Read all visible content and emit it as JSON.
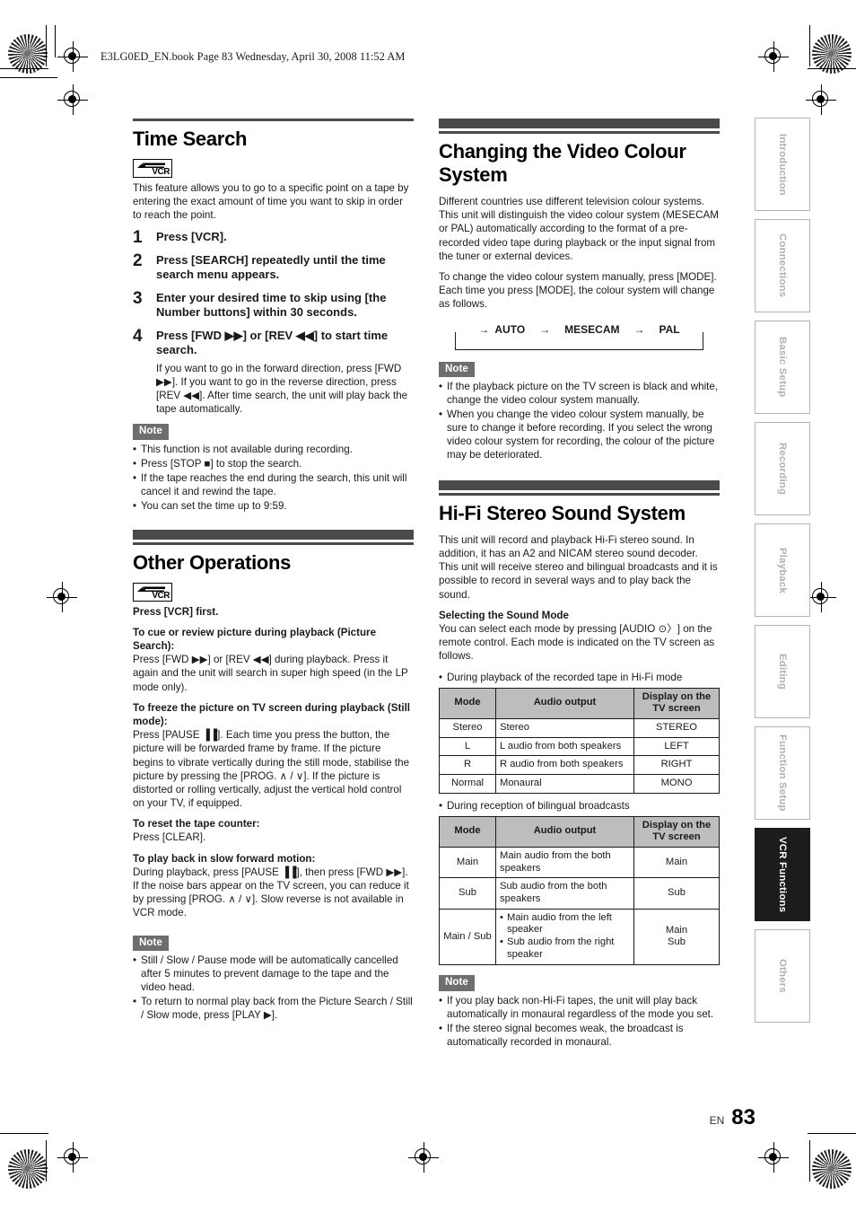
{
  "header": {
    "file_line": "E3LG0ED_EN.book  Page 83  Wednesday, April 30, 2008  11:52 AM"
  },
  "footer": {
    "lang": "EN",
    "page_number": "83"
  },
  "side_tabs": {
    "items": [
      {
        "label": "Introduction",
        "active": false
      },
      {
        "label": "Connections",
        "active": false
      },
      {
        "label": "Basic Setup",
        "active": false
      },
      {
        "label": "Recording",
        "active": false
      },
      {
        "label": "Playback",
        "active": false
      },
      {
        "label": "Editing",
        "active": false
      },
      {
        "label": "Function Setup",
        "active": false
      },
      {
        "label": "VCR Functions",
        "active": true
      },
      {
        "label": "Others",
        "active": false
      }
    ]
  },
  "icons": {
    "vcr_label": "VCR"
  },
  "left_column": {
    "time_search": {
      "title": "Time Search",
      "intro": "This feature allows you to go to a specific point on a tape by entering the exact amount of time you want to skip in order to reach the point.",
      "steps": [
        {
          "num": "1",
          "text": "Press [VCR].",
          "detail": ""
        },
        {
          "num": "2",
          "text": "Press [SEARCH] repeatedly until the time search menu appears.",
          "detail": ""
        },
        {
          "num": "3",
          "text": "Enter your desired time to skip using [the Number buttons] within 30 seconds.",
          "detail": ""
        },
        {
          "num": "4",
          "text": "Press [FWD ▶▶] or [REV ◀◀] to start time search.",
          "detail": "If you want to go in the forward direction, press [FWD ▶▶]. If you want to go in the reverse direction, press [REV ◀◀]. After time search, the unit will play back the tape automatically."
        }
      ],
      "note_label": "Note",
      "notes": [
        "This function is not available during recording.",
        "Press [STOP ■] to stop the search.",
        "If the tape reaches the end during the search, this unit will cancel it and rewind the tape.",
        "You can set the time up to 9:59."
      ]
    },
    "other_operations": {
      "title": "Other Operations",
      "press_first": "Press [VCR] first.",
      "blocks": [
        {
          "heading": "To cue or review picture during playback (Picture Search):",
          "body": "Press [FWD ▶▶] or [REV ◀◀] during playback. Press it again and the unit will search in super high speed (in the LP mode only)."
        },
        {
          "heading": "To freeze the picture on TV screen during playback (Still mode):",
          "body": "Press [PAUSE ▐▐]. Each time you press the button, the picture will be forwarded frame by frame. If the picture begins to vibrate vertically during the still mode, stabilise the picture by pressing the [PROG. ∧ / ∨]. If the picture is distorted or rolling vertically, adjust the vertical hold control on your TV, if equipped."
        },
        {
          "heading": "To reset the tape counter:",
          "body": "Press [CLEAR]."
        },
        {
          "heading": "To play back in slow forward motion:",
          "body": "During playback, press [PAUSE ▐▐], then press [FWD ▶▶]. If the noise bars appear on the TV screen, you can reduce it by pressing [PROG. ∧ / ∨]. Slow reverse is not available in VCR mode."
        }
      ],
      "note_label": "Note",
      "notes": [
        "Still / Slow / Pause mode will be automatically cancelled after 5 minutes to prevent damage to the tape and the video head.",
        "To return to normal play back from the Picture Search / Still / Slow mode, press [PLAY ▶]."
      ]
    }
  },
  "right_column": {
    "video_colour": {
      "title": "Changing the Video Colour System",
      "para1": "Different countries use different television colour systems.",
      "para2": "This unit will distinguish the video colour system (MESECAM or PAL) automatically according to the format of a pre-recorded video tape during playback or the input signal from the tuner or external devices.",
      "para3": "To change the video colour system manually, press [MODE].",
      "para4": "Each time you press [MODE], the colour system will change as follows.",
      "cycle": [
        "AUTO",
        "MESECAM",
        "PAL"
      ],
      "cycle_arrow": "→",
      "note_label": "Note",
      "notes": [
        "If the playback picture on the TV screen is black and white, change the video colour system manually.",
        "When you change the video colour system manually, be sure to change it before recording. If you select the wrong video colour system for recording, the colour of the picture may be deteriorated."
      ]
    },
    "hifi": {
      "title": "Hi-Fi Stereo Sound System",
      "intro": "This unit will record and playback Hi-Fi stereo sound. In addition, it has an A2 and NICAM stereo sound decoder. This unit will receive stereo and bilingual broadcasts and it is possible to record in several ways and to play back the sound.",
      "sound_mode_heading": "Selecting the Sound Mode",
      "sound_mode_body": "You can select each mode by pressing [AUDIO ⊙〉] on the remote control. Each mode is indicated on the TV screen as follows.",
      "table1_caption": "During playback of the recorded tape in Hi-Fi mode",
      "table1": {
        "headers": [
          "Mode",
          "Audio output",
          "Display on the TV screen"
        ],
        "rows": [
          {
            "mode": "Stereo",
            "audio": "Stereo",
            "display": "STEREO"
          },
          {
            "mode": "L",
            "audio": "L audio from both speakers",
            "display": "LEFT"
          },
          {
            "mode": "R",
            "audio": "R audio from both speakers",
            "display": "RIGHT"
          },
          {
            "mode": "Normal",
            "audio": "Monaural",
            "display": "MONO"
          }
        ]
      },
      "table2_caption": "During reception of bilingual broadcasts",
      "table2": {
        "headers": [
          "Mode",
          "Audio output",
          "Display on the TV screen"
        ],
        "rows": [
          {
            "mode": "Main",
            "audio": "Main audio from the both speakers",
            "display": "Main"
          },
          {
            "mode": "Sub",
            "audio": "Sub audio from the both speakers",
            "display": "Sub"
          },
          {
            "mode": "Main / Sub",
            "audio_list": [
              "Main audio from the left speaker",
              "Sub audio from the right speaker"
            ],
            "display": "Main\nSub"
          }
        ]
      },
      "note_label": "Note",
      "notes": [
        "If you play back non-Hi-Fi tapes, the unit will play back automatically in monaural regardless of the mode you set.",
        "If the stereo signal becomes weak, the broadcast is automatically recorded in monaural."
      ]
    }
  },
  "colors": {
    "rule": "#4a4a4a",
    "note_badge": "#6e6e6e",
    "table_header": "#bdbdbd",
    "tab_inactive_text": "#b0b0b0",
    "tab_active_bg": "#1c1c1c"
  }
}
